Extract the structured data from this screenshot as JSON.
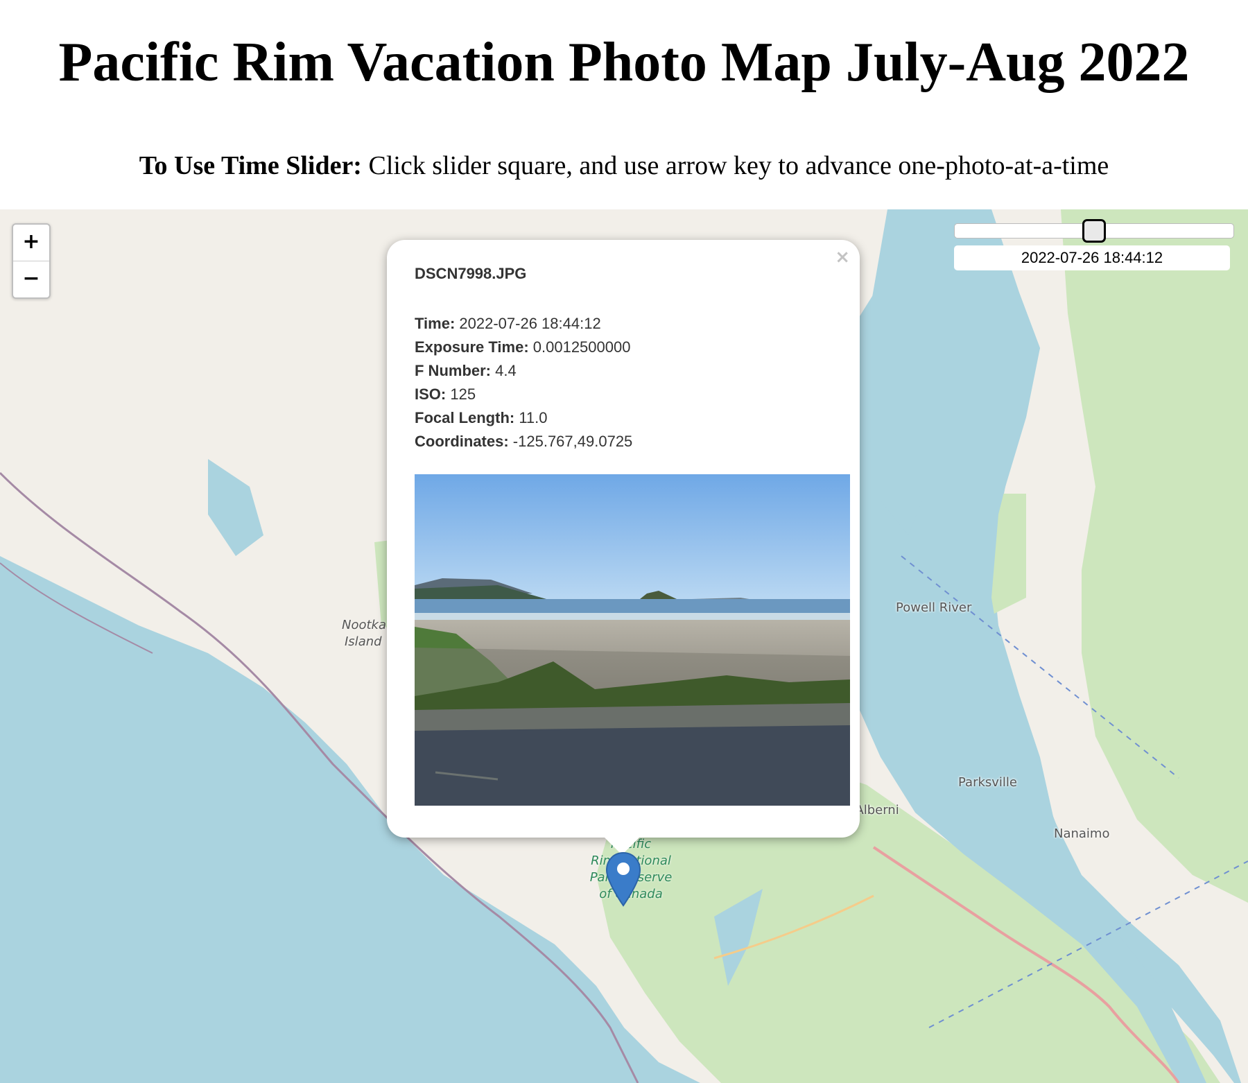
{
  "page": {
    "title": "Pacific Rim Vacation Photo Map July-Aug 2022",
    "instructions_bold": "To Use Time Slider:",
    "instructions_text": " Click slider square, and use arrow key to advance one-photo-at-a-time"
  },
  "zoom": {
    "in_label": "+",
    "out_label": "−"
  },
  "slider": {
    "time": "2022-07-26 18:44:12",
    "position_fraction": 0.5
  },
  "popup": {
    "close_label": "×",
    "filename": "DSCN7998.JPG",
    "fields": [
      {
        "key": "Time:",
        "value": " 2022-07-26 18:44:12"
      },
      {
        "key": "Exposure Time:",
        "value": " 0.0012500000"
      },
      {
        "key": "F Number:",
        "value": " 4.4"
      },
      {
        "key": "ISO:",
        "value": " 125"
      },
      {
        "key": "Focal Length:",
        "value": " 11.0"
      },
      {
        "key": "Coordinates:",
        "value": " -125.767,49.0725"
      }
    ]
  },
  "map_labels": {
    "powell_river": "Powell River",
    "parksville": "Parksville",
    "port_alberni": "Port Alberni",
    "nanaimo": "Nanaimo",
    "nootka_1": "Nootka",
    "nootka_2": "Island",
    "park_1": "Pacific",
    "park_2": "Rim National",
    "park_3": "Park Reserve",
    "park_4": "of Canada"
  },
  "colors": {
    "water": "#aad3df",
    "land": "#f2efe9",
    "forest": "#cde6bd",
    "marker": "#3a7cc9"
  }
}
